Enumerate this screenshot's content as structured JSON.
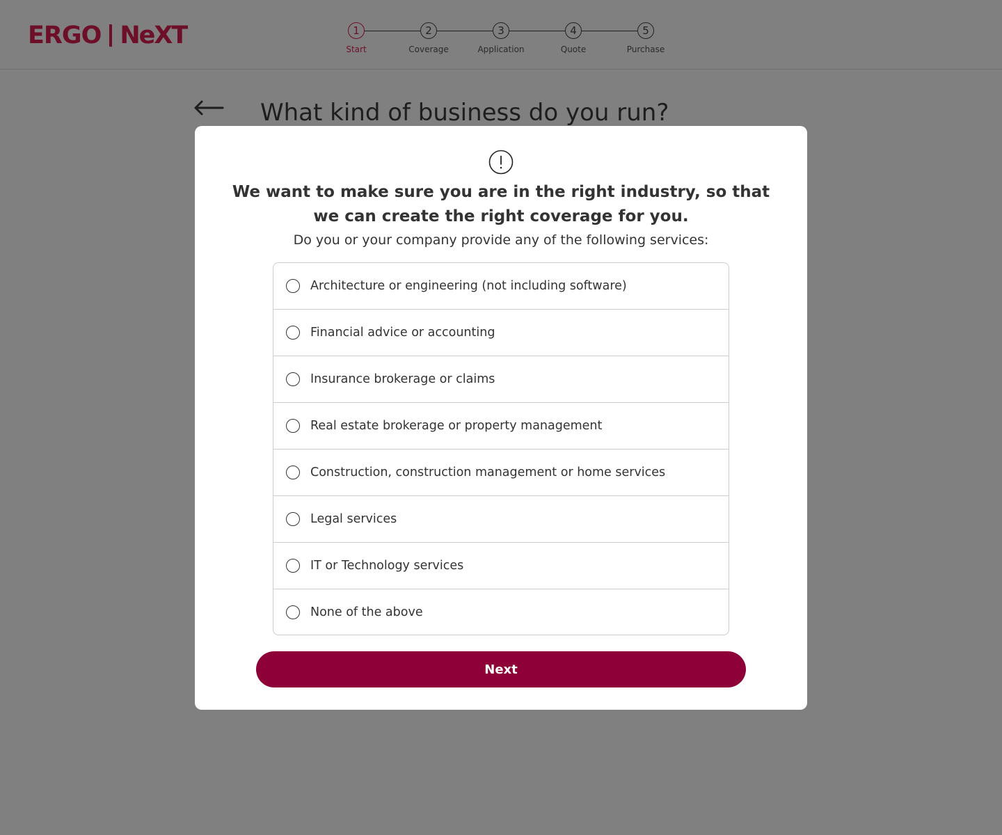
{
  "brand": {
    "part1": "ERGO",
    "part2": "NeXT",
    "color": "#6d0f28"
  },
  "stepper": {
    "current_step": 1,
    "steps": [
      {
        "number": "1",
        "label": "Start"
      },
      {
        "number": "2",
        "label": "Coverage"
      },
      {
        "number": "3",
        "label": "Application"
      },
      {
        "number": "4",
        "label": "Quote"
      },
      {
        "number": "5",
        "label": "Purchase"
      }
    ]
  },
  "page": {
    "back_icon": "arrow-left-icon",
    "title": "What kind of business do you run?"
  },
  "modal": {
    "icon": "exclamation-circle-icon",
    "heading": "We want to make sure you are in the right industry, so that we can create the right coverage for you.",
    "subheading": "Do you or your company provide any of the following services:",
    "options": [
      {
        "label": "Architecture or engineering (not including software)",
        "selected": false
      },
      {
        "label": "Financial advice or accounting",
        "selected": false
      },
      {
        "label": "Insurance brokerage or claims",
        "selected": false
      },
      {
        "label": "Real estate brokerage or property management",
        "selected": false
      },
      {
        "label": "Construction, construction management or home services",
        "selected": false
      },
      {
        "label": "Legal services",
        "selected": false
      },
      {
        "label": "IT or Technology services",
        "selected": false
      },
      {
        "label": "None of the above",
        "selected": false
      }
    ],
    "next_label": "Next",
    "button_color": "#8e0038"
  },
  "overlay_color": "#808080"
}
